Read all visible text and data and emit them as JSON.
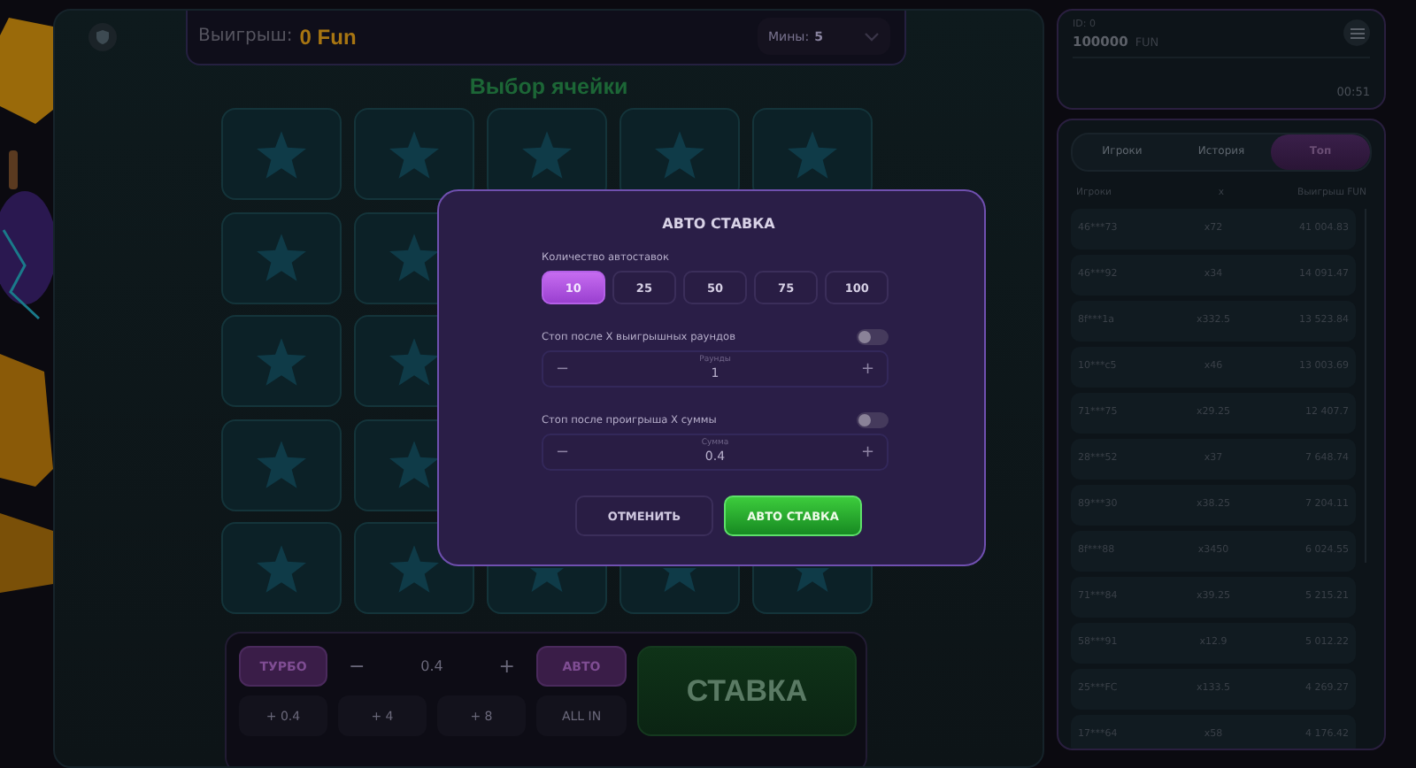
{
  "game": {
    "win": {
      "label": "Выигрыш:",
      "amount": "0 Fun"
    },
    "mines": {
      "label": "Мины:",
      "value": "5"
    },
    "title": "Выбор ячейки",
    "controls": {
      "turbo": "ТУРБО",
      "minus": "−",
      "bet": "0.4",
      "plus": "+",
      "auto": "АВТО",
      "place": "СТАВКА",
      "quick": [
        "+ 0.4",
        "+ 4",
        "+ 8",
        "ALL IN"
      ]
    }
  },
  "account": {
    "id": "ID: 0",
    "balance": "100000",
    "currency": "FUN",
    "time": "00:51"
  },
  "board": {
    "tabs": [
      {
        "label": "Игроки",
        "selected": false
      },
      {
        "label": "История",
        "selected": false
      },
      {
        "label": "Топ",
        "selected": true
      }
    ],
    "columns": [
      "Игроки",
      "x",
      "Выигрыш FUN"
    ],
    "rows": [
      {
        "player": "46***73",
        "multiplier": "x72",
        "win": "41 004.83"
      },
      {
        "player": "46***92",
        "multiplier": "x34",
        "win": "14 091.47"
      },
      {
        "player": "8f***1a",
        "multiplier": "x332.5",
        "win": "13 523.84"
      },
      {
        "player": "10***c5",
        "multiplier": "x46",
        "win": "13 003.69"
      },
      {
        "player": "71***75",
        "multiplier": "x29.25",
        "win": "12 407.7"
      },
      {
        "player": "28***52",
        "multiplier": "x37",
        "win": "7 648.74"
      },
      {
        "player": "89***30",
        "multiplier": "x38.25",
        "win": "7 204.11"
      },
      {
        "player": "8f***88",
        "multiplier": "x3450",
        "win": "6 024.55"
      },
      {
        "player": "71***84",
        "multiplier": "x39.25",
        "win": "5 215.21"
      },
      {
        "player": "58***91",
        "multiplier": "x12.9",
        "win": "5 012.22"
      },
      {
        "player": "25***FC",
        "multiplier": "x133.5",
        "win": "4 269.27"
      },
      {
        "player": "17***64",
        "multiplier": "x58",
        "win": "4 176.42"
      }
    ]
  },
  "modal": {
    "title": "АВТО СТАВКА",
    "count_label": "Количество автоставок",
    "counts": [
      {
        "label": "10",
        "selected": true
      },
      {
        "label": "25",
        "selected": false
      },
      {
        "label": "50",
        "selected": false
      },
      {
        "label": "75",
        "selected": false
      },
      {
        "label": "100",
        "selected": false
      }
    ],
    "stops": [
      {
        "label": "Стоп после X выигрышных раундов",
        "on": false,
        "field_label": "Раунды",
        "value": "1",
        "minus": "−",
        "plus": "+"
      },
      {
        "label": "Стоп после проигрыша X суммы",
        "on": false,
        "field_label": "Сумма",
        "value": "0.4",
        "minus": "−",
        "plus": "+"
      }
    ],
    "buttons": [
      {
        "label": "ОТМЕНИТЬ",
        "kind": "secondary"
      },
      {
        "label": "АВТО СТАВКА",
        "kind": "primary"
      }
    ]
  }
}
